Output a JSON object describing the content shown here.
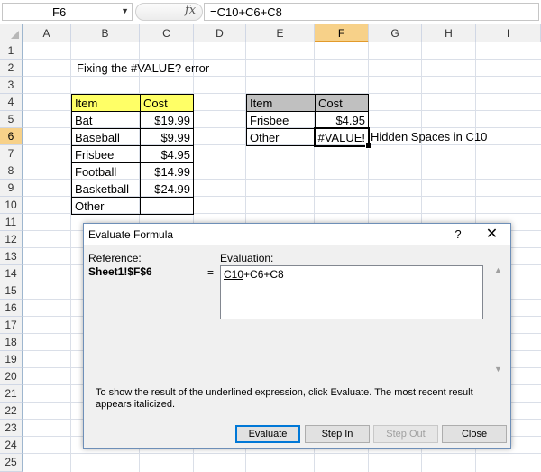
{
  "formula_bar": {
    "name_box": "F6",
    "fx_label": "fx",
    "formula": "=C10+C6+C8"
  },
  "columns": [
    "A",
    "B",
    "C",
    "D",
    "E",
    "F",
    "G",
    "H",
    "I"
  ],
  "active_column": "F",
  "rows": [
    "1",
    "2",
    "3",
    "4",
    "5",
    "6",
    "7",
    "8",
    "9",
    "10",
    "11",
    "12",
    "13",
    "14",
    "15",
    "16",
    "17",
    "18",
    "19",
    "20",
    "21",
    "22",
    "23",
    "24",
    "25"
  ],
  "active_row": "6",
  "sheet": {
    "title_text": "Fixing the #VALUE? error",
    "table1": {
      "headers": [
        "Item",
        "Cost"
      ],
      "rows": [
        [
          "Bat",
          "$19.99"
        ],
        [
          "Baseball",
          "$9.99"
        ],
        [
          "Frisbee",
          "$4.95"
        ],
        [
          "Football",
          "$14.99"
        ],
        [
          "Basketball",
          "$24.99"
        ],
        [
          "Other",
          ""
        ]
      ]
    },
    "table2": {
      "headers": [
        "Item",
        "Cost"
      ],
      "rows": [
        [
          "Frisbee",
          "$4.95"
        ],
        [
          "Other",
          "#VALUE!"
        ]
      ]
    },
    "note": "Hidden Spaces in C10"
  },
  "dialog": {
    "title": "Evaluate Formula",
    "help": "?",
    "close_glyph": "✕",
    "reference_label": "Reference:",
    "reference_value": "Sheet1!$F$6",
    "equals": "=",
    "evaluation_label": "Evaluation:",
    "evaluation_underlined": "C10",
    "evaluation_rest": "+C6+C8",
    "hint": "To show the result of the underlined expression, click Evaluate.  The most recent result appears italicized.",
    "buttons": {
      "evaluate": "Evaluate",
      "step_in": "Step In",
      "step_out": "Step Out",
      "close": "Close"
    }
  },
  "colors": {
    "header_yellow": "#ffff66",
    "header_gray": "#c0c0c0",
    "active_header": "#f7d189"
  }
}
